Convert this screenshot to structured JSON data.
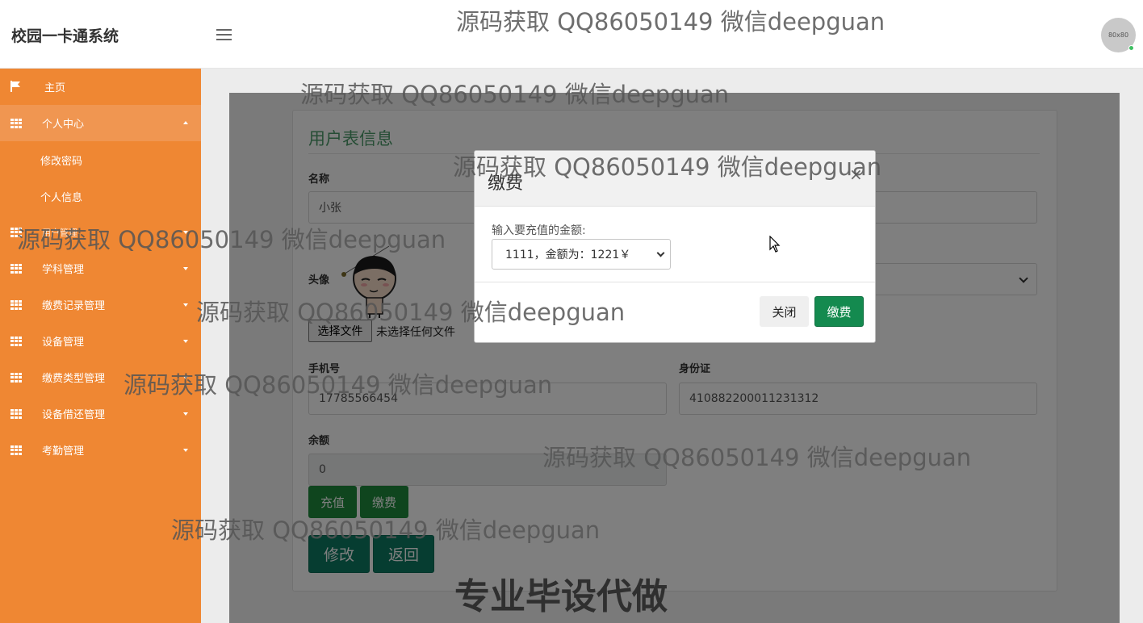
{
  "header": {
    "brand": "校园一卡通系统",
    "avatar_text": "80x80"
  },
  "sidebar": {
    "home": "主页",
    "personal_center": "个人中心",
    "sub_items": [
      "修改密码",
      "个人信息"
    ],
    "menu_hidden_label": "用户管理",
    "items": [
      "学科管理",
      "缴费记录管理",
      "设备管理",
      "缴费类型管理",
      "设备借还管理",
      "考勤管理"
    ]
  },
  "form": {
    "title": "用户表信息",
    "name_label": "名称",
    "name_value": "小张",
    "avatar_label": "头像",
    "file_button": "选择文件",
    "file_status": "未选择任何文件",
    "phone_label": "手机号",
    "phone_value": "17785566454",
    "id_label": "身份证",
    "id_value": "410882200011231312",
    "balance_label": "余额",
    "balance_value": "0",
    "recharge_button": "充值",
    "pay_button": "缴费",
    "edit_button": "修改",
    "back_button": "返回"
  },
  "modal": {
    "title": "缴费",
    "close_symbol": "×",
    "label": "输入要充值的金额:",
    "selected_option": "1111，金额为：1221￥",
    "close_button": "关闭",
    "pay_button": "缴费"
  },
  "watermarks": {
    "text": "源码获取 QQ86050149 微信deepguan",
    "promo": "专业毕设代做"
  },
  "colors": {
    "sidebar": "#ef8733",
    "sidebar_active": "#f09651",
    "title_green": "#4d9b6b",
    "button_green": "#1f8a3c",
    "button_teal": "#0c7a62"
  }
}
